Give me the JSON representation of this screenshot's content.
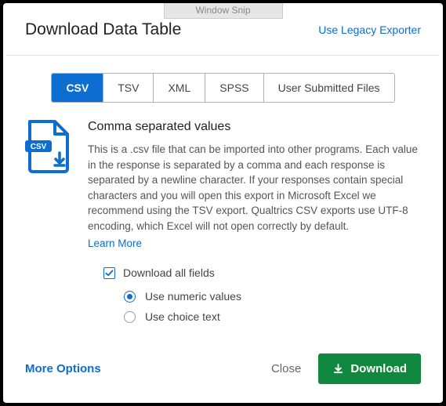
{
  "window_snip": "Window Snip",
  "header": {
    "title": "Download Data Table",
    "legacy_link": "Use Legacy Exporter"
  },
  "tabs": {
    "csv": "CSV",
    "tsv": "TSV",
    "xml": "XML",
    "spss": "SPSS",
    "user_files": "User Submitted Files"
  },
  "format": {
    "title": "Comma separated values",
    "description": "This is a .csv file that can be imported into other programs. Each value in the response is separated by a comma and each response is separated by a newline character. If your responses contain special characters and you will open this export in Microsoft Excel we recommend using the TSV export. Qualtrics CSV exports use UTF-8 encoding, which Excel will not open correctly by default.",
    "learn_more": "Learn More",
    "icon_badge": "CSV"
  },
  "options": {
    "download_all_fields": "Download all fields",
    "use_numeric_values": "Use numeric values",
    "use_choice_text": "Use choice text"
  },
  "footer": {
    "more_options": "More Options",
    "close": "Close",
    "download": "Download"
  }
}
